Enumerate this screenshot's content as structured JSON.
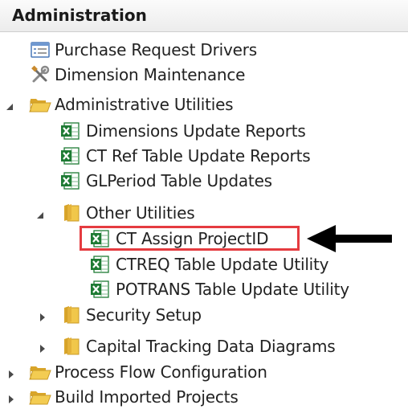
{
  "panel": {
    "title": "Administration"
  },
  "tree": {
    "purchase_request_drivers": "Purchase Request Drivers",
    "dimension_maintenance": "Dimension Maintenance",
    "administrative_utilities": "Administrative Utilities",
    "dimensions_update_reports": "Dimensions Update Reports",
    "ct_ref_table_update_reports": "CT Ref Table Update Reports",
    "glperiod_table_updates": "GLPeriod Table Updates",
    "other_utilities": "Other Utilities",
    "ct_assign_projectid": "CT Assign ProjectID",
    "ctreq_table_update_utility": "CTREQ Table Update Utility",
    "potrans_table_update_utility": "POTRANS Table Update Utility",
    "security_setup": "Security Setup",
    "capital_tracking_data_diagrams": "Capital Tracking Data Diagrams",
    "process_flow_configuration": "Process Flow Configuration",
    "build_imported_projects": "Build Imported Projects"
  },
  "icons": {
    "excel_green": "#1e7b34",
    "folder_yellow": "#e8b830",
    "highlight_color": "#e53b40",
    "arrow_color": "#000000"
  }
}
